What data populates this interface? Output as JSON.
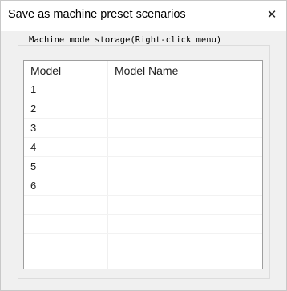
{
  "window": {
    "title": "Save as machine preset scenarios",
    "close_glyph": "✕"
  },
  "group": {
    "label": "Machine mode storage(Right-click menu)"
  },
  "table": {
    "columns": [
      "Model",
      "Model Name"
    ],
    "rows": [
      {
        "model": "1",
        "name": ""
      },
      {
        "model": "2",
        "name": ""
      },
      {
        "model": "3",
        "name": ""
      },
      {
        "model": "4",
        "name": ""
      },
      {
        "model": "5",
        "name": ""
      },
      {
        "model": "6",
        "name": ""
      },
      {
        "model": "",
        "name": ""
      },
      {
        "model": "",
        "name": ""
      },
      {
        "model": "",
        "name": ""
      }
    ]
  }
}
